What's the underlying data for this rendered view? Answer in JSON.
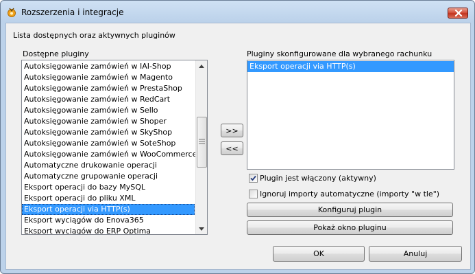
{
  "window": {
    "title": "Rozszerzenia i integracje"
  },
  "header": {
    "description": "Lista dostępnych oraz aktywnych pluginów"
  },
  "available": {
    "label": "Dostępne pluginy",
    "items": [
      "Autoksięgowanie zamówień w IAI-Shop",
      "Autoksięgowanie zamówień w Magento",
      "Autoksięgowanie zamówień w PrestaShop",
      "Autoksięgowanie zamówień w RedCart",
      "Autoksięgowanie zamówień w Sello",
      "Autoksięgowanie zamówień w Shoper",
      "Autoksięgowanie zamówień w SkyShop",
      "Autoksięgowanie zamówień w SoteShop",
      "Autoksięgowanie zamówień w WooCommerce",
      "Automatyczne drukowanie operacji",
      "Automatyczne grupowanie operacji",
      "Eksport operacji do bazy MySQL",
      "Eksport operacji do pliku XML",
      "Eksport operacji via HTTP(s)",
      "Eksport wyciągów do Enova365",
      "Eksport wyciągów do ERP Optima"
    ],
    "selected": "Eksport operacji via HTTP(s)"
  },
  "transfer": {
    "add_label": ">>",
    "remove_label": "<<"
  },
  "configured": {
    "label": "Pluginy skonfigurowane dla wybranego rachunku",
    "items": [
      "Eksport operacji via HTTP(s)"
    ]
  },
  "options": {
    "enabled_label": "Plugin jest włączony (aktywny)",
    "enabled_checked": true,
    "ignore_label": "Ignoruj importy automatyczne (importy \"w tle\")",
    "ignore_checked": false
  },
  "actions": {
    "configure_label": "Konfiguruj plugin",
    "show_window_label": "Pokaż okno pluginu"
  },
  "footer": {
    "ok_label": "OK",
    "cancel_label": "Anuluj"
  },
  "colors": {
    "selection": "#3399ff",
    "close_button": "#c2341f",
    "frame": "#bcd2ea"
  }
}
